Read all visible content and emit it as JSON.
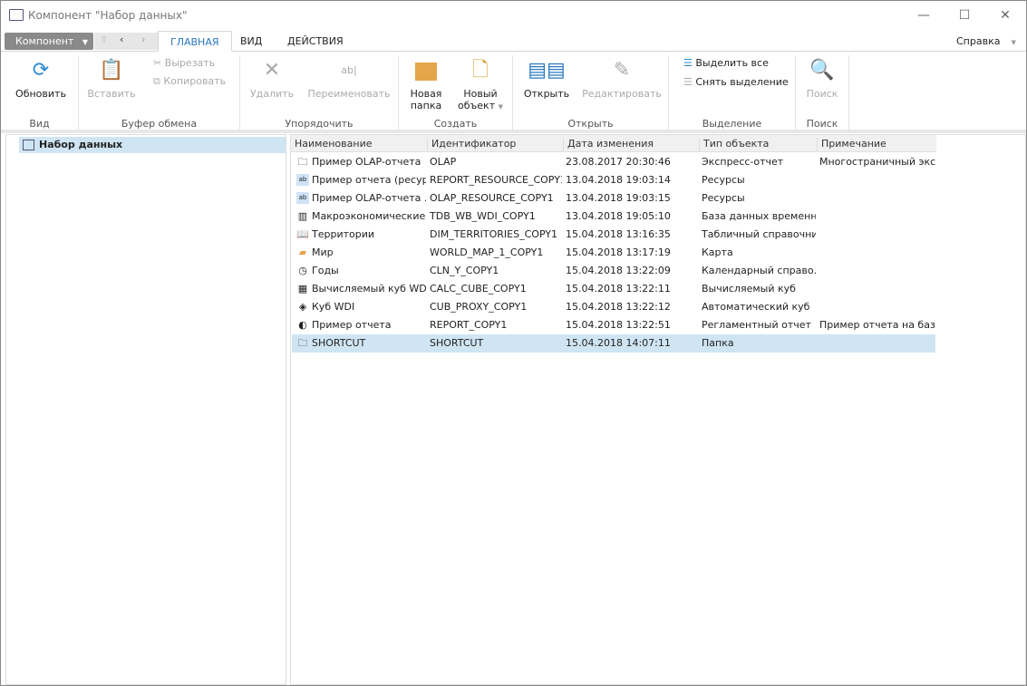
{
  "window": {
    "title": "Компонент \"Набор данных\"",
    "minimize": "—",
    "maximize": "☐",
    "close": "✕"
  },
  "tabs": {
    "component": "Компонент",
    "items": [
      "ГЛАВНАЯ",
      "ВИД",
      "ДЕЙСТВИЯ"
    ],
    "help": "Справка"
  },
  "ribbon": {
    "view": {
      "refresh": "Обновить",
      "group": "Вид"
    },
    "clipboard": {
      "paste": "Вставить",
      "cut": "Вырезать",
      "copy": "Копировать",
      "group": "Буфер обмена"
    },
    "organize": {
      "delete": "Удалить",
      "rename": "Переименовать",
      "group": "Упорядочить"
    },
    "create": {
      "new_folder_1": "Новая",
      "new_folder_2": "папка",
      "new_object_1": "Новый",
      "new_object_2": "объект",
      "group": "Создать"
    },
    "open": {
      "open": "Открыть",
      "edit": "Редактировать",
      "group": "Открыть"
    },
    "selection": {
      "select_all": "Выделить все",
      "deselect": "Снять выделение",
      "group": "Выделение"
    },
    "search": {
      "search": "Поиск",
      "group": "Поиск"
    }
  },
  "tree": {
    "root": "Набор данных"
  },
  "table": {
    "columns": [
      "Наименование",
      "Идентификатор",
      "Дата изменения",
      "Тип объекта",
      "Примечание"
    ],
    "rows": [
      {
        "icon": "olap-report-icon",
        "name": "Пример OLAP-отчета",
        "id": "OLAP",
        "date": "23.08.2017 20:30:46",
        "type": "Экспресс-отчет",
        "note": "Многостраничный экс..."
      },
      {
        "icon": "resource-icon",
        "name": "Пример отчета (ресур...",
        "id": "REPORT_RESOURCE_COPY1",
        "date": "13.04.2018 19:03:14",
        "type": "Ресурсы",
        "note": ""
      },
      {
        "icon": "resource-icon",
        "name": "Пример OLAP-отчета ...",
        "id": "OLAP_RESOURCE_COPY1",
        "date": "13.04.2018 19:03:15",
        "type": "Ресурсы",
        "note": ""
      },
      {
        "icon": "database-icon",
        "name": "Макроэкономические ...",
        "id": "TDB_WB_WDI_COPY1",
        "date": "13.04.2018 19:05:10",
        "type": "База данных временн...",
        "note": ""
      },
      {
        "icon": "dictionary-icon",
        "name": "Территории",
        "id": "DIM_TERRITORIES_COPY1",
        "date": "15.04.2018 13:16:35",
        "type": "Табличный справочни...",
        "note": ""
      },
      {
        "icon": "map-icon",
        "name": "Мир",
        "id": "WORLD_MAP_1_COPY1",
        "date": "15.04.2018 13:17:19",
        "type": "Карта",
        "note": ""
      },
      {
        "icon": "calendar-icon",
        "name": "Годы",
        "id": "CLN_Y_COPY1",
        "date": "15.04.2018 13:22:09",
        "type": "Календарный справо...",
        "note": ""
      },
      {
        "icon": "calc-cube-icon",
        "name": "Вычисляемый куб WDI",
        "id": "CALC_CUBE_COPY1",
        "date": "15.04.2018 13:22:11",
        "type": "Вычисляемый куб",
        "note": ""
      },
      {
        "icon": "auto-cube-icon",
        "name": "Куб WDI",
        "id": "CUB_PROXY_COPY1",
        "date": "15.04.2018 13:22:12",
        "type": "Автоматический куб",
        "note": ""
      },
      {
        "icon": "report-icon",
        "name": "Пример отчета",
        "id": "REPORT_COPY1",
        "date": "15.04.2018 13:22:51",
        "type": "Регламентный отчет",
        "note": "Пример отчета на баз..."
      },
      {
        "icon": "folder-icon",
        "name": "SHORTCUT",
        "id": "SHORTCUT",
        "date": "15.04.2018 14:07:11",
        "type": "Папка",
        "note": ""
      }
    ],
    "selected_index": 10
  }
}
